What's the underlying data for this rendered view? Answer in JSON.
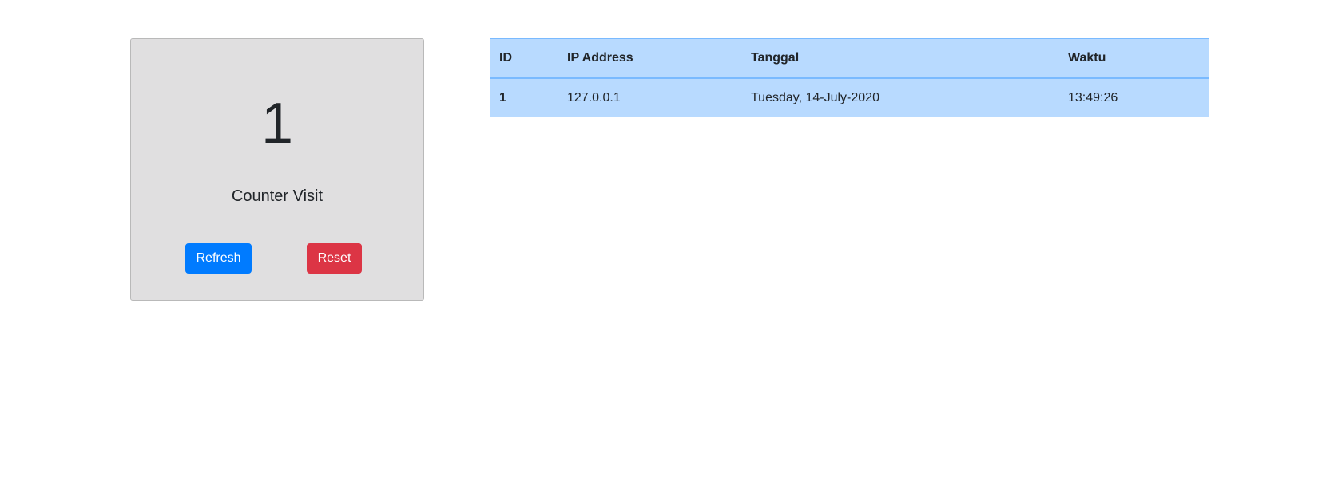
{
  "counter": {
    "value": "1",
    "label": "Counter Visit",
    "refresh_label": "Refresh",
    "reset_label": "Reset"
  },
  "table": {
    "headers": [
      "ID",
      "IP Address",
      "Tanggal",
      "Waktu"
    ],
    "rows": [
      {
        "id": "1",
        "ip": "127.0.0.1",
        "date": "Tuesday, 14-July-2020",
        "time": "13:49:26"
      }
    ]
  },
  "colors": {
    "card_background": "#e0dfe0",
    "refresh_button": "#007bff",
    "reset_button": "#dc3545",
    "table_background": "#b8daff"
  }
}
